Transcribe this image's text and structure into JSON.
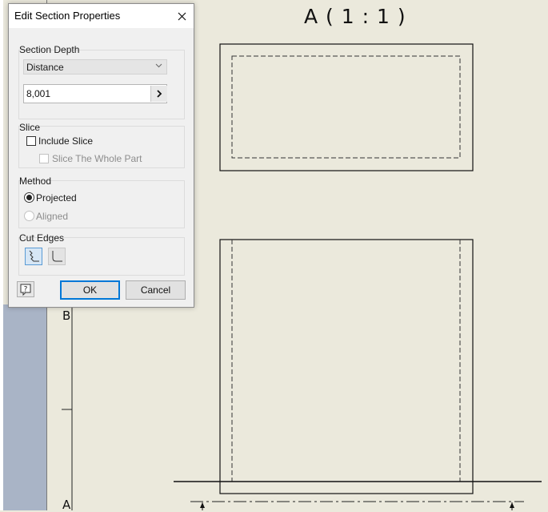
{
  "drawing": {
    "view_title": "A ( 1 : 1 )",
    "zone_labels": [
      "B",
      "A"
    ]
  },
  "dialog": {
    "title": "Edit Section Properties",
    "close_icon": "close-icon",
    "section_depth": {
      "label": "Section Depth",
      "mode_selected": "Distance",
      "distance_value": "8,001",
      "apply_icon": "chevron-right-icon"
    },
    "slice": {
      "label": "Slice",
      "include_slice_label": "Include Slice",
      "include_slice_checked": false,
      "slice_whole_part_label": "Slice The Whole Part",
      "slice_whole_part_checked": false,
      "slice_whole_part_enabled": false
    },
    "method": {
      "label": "Method",
      "options": [
        {
          "label": "Projected",
          "selected": true,
          "enabled": true
        },
        {
          "label": "Aligned",
          "selected": false,
          "enabled": false
        }
      ]
    },
    "cut_edges": {
      "label": "Cut Edges",
      "buttons": [
        {
          "icon": "smooth-cut-edge-icon",
          "active": true
        },
        {
          "icon": "straight-cut-edge-icon",
          "active": false
        }
      ]
    },
    "footer": {
      "help_icon": "help-icon",
      "ok_label": "OK",
      "cancel_label": "Cancel"
    }
  }
}
